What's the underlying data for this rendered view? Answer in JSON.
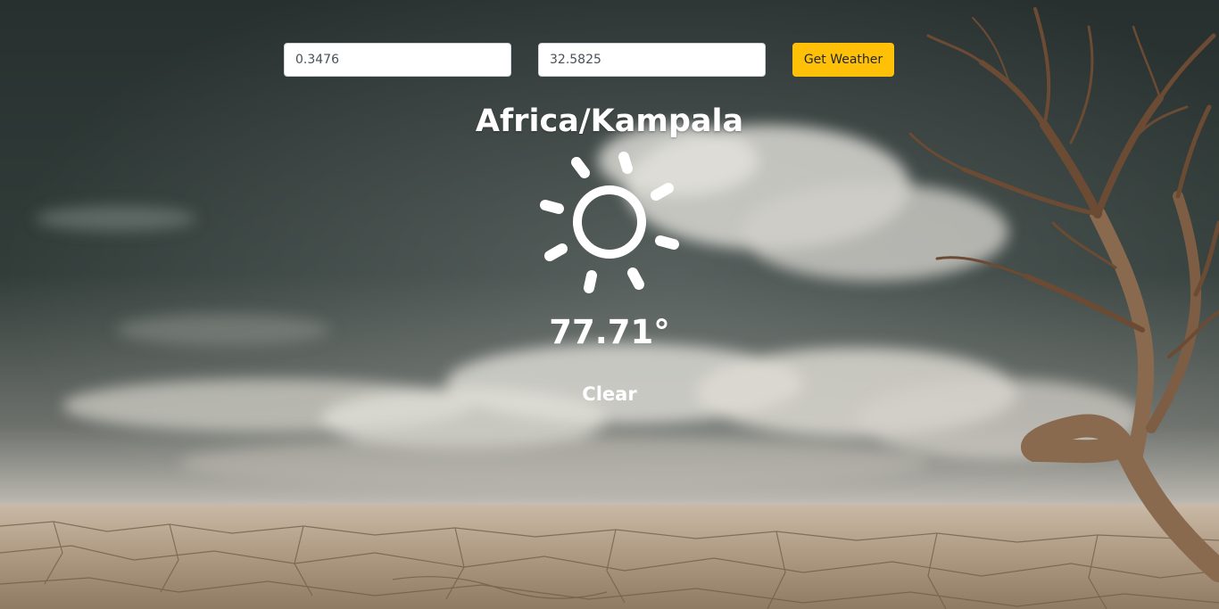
{
  "form": {
    "latitude_value": "0.3476",
    "longitude_value": "32.5825",
    "submit_label": "Get Weather"
  },
  "weather": {
    "timezone": "Africa/Kampala",
    "icon": "clear-day-sun-icon",
    "temperature": "77.71°",
    "summary": "Clear"
  },
  "colors": {
    "button_background": "#ffc107",
    "text": "#ffffff",
    "sky_dark": "#2a3432",
    "ground": "#a8927a"
  }
}
